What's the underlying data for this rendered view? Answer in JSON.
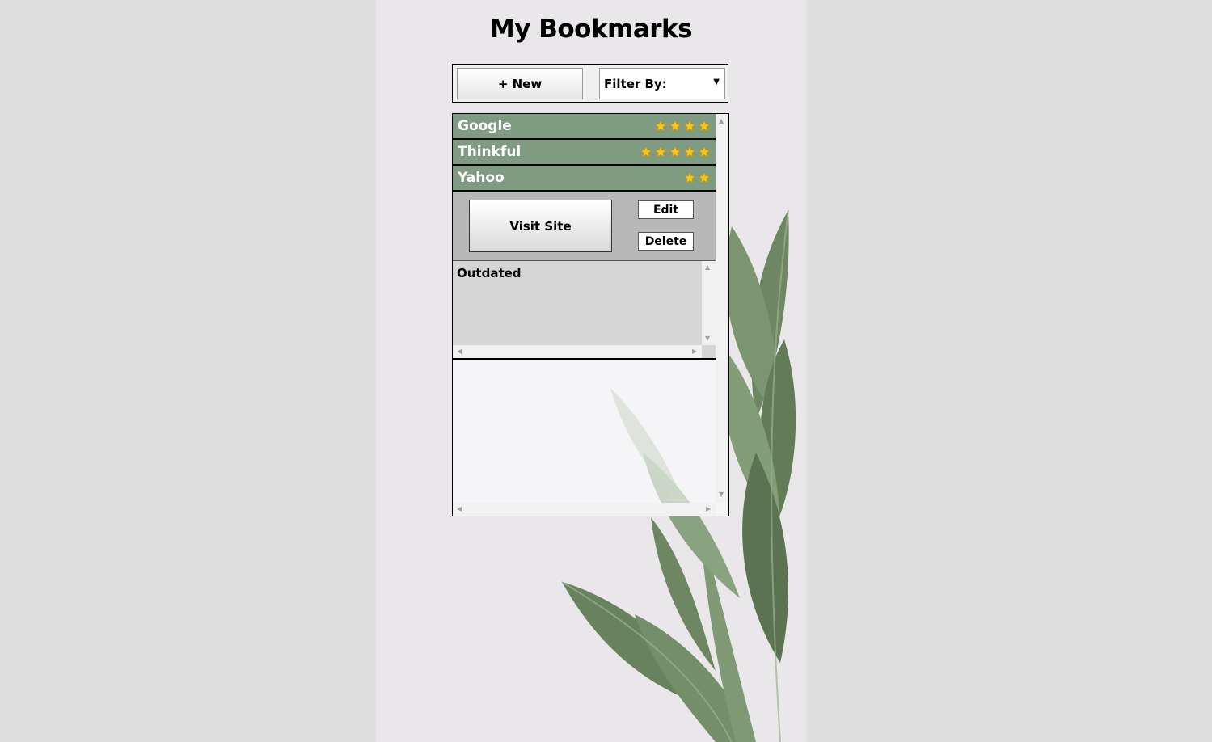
{
  "header": {
    "title": "My Bookmarks"
  },
  "toolbar": {
    "new_label": "+ New",
    "filter_label": "Filter By:"
  },
  "bookmarks": [
    {
      "name": "Google",
      "rating": 4
    },
    {
      "name": "Thinkful",
      "rating": 5
    },
    {
      "name": "Yahoo",
      "rating": 2
    }
  ],
  "expanded": {
    "visit_label": "Visit Site",
    "edit_label": "Edit",
    "delete_label": "Delete",
    "description": "Outdated"
  },
  "colors": {
    "row_bg": "#7f9c83",
    "star": "#f5c518",
    "leaf": "#5f7a55"
  },
  "icons": {
    "star": "star-icon",
    "caret": "caret-down-icon",
    "scroll_up": "scroll-up-arrow-icon",
    "scroll_down": "scroll-down-arrow-icon",
    "scroll_left": "scroll-left-arrow-icon",
    "scroll_right": "scroll-right-arrow-icon"
  }
}
